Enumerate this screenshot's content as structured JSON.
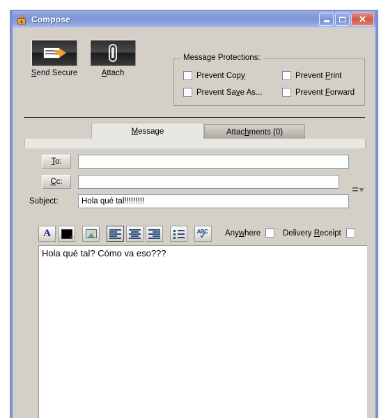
{
  "window": {
    "title": "Compose",
    "icon": "lock-icon",
    "buttons": {
      "minimize": "minimize-icon",
      "maximize": "maximize-icon",
      "close": "close-icon"
    }
  },
  "toolbar": {
    "buttons": [
      {
        "label_pre": "S",
        "label_post": "end Secure",
        "icon": "send-envelope-icon",
        "name": "send-secure-button"
      },
      {
        "label_pre": "A",
        "label_post": "ttach",
        "icon": "paperclip-icon",
        "name": "attach-button"
      }
    ]
  },
  "protections": {
    "title": "Message Protections:",
    "items": [
      {
        "pre": "Prevent Cop",
        "acc": "y",
        "post": "",
        "checked": false,
        "name": "prevent-copy-checkbox"
      },
      {
        "pre": "Prevent Sa",
        "acc": "v",
        "post": "e As...",
        "checked": false,
        "name": "prevent-save-as-checkbox"
      },
      {
        "pre": "Prevent ",
        "acc": "P",
        "post": "rint",
        "checked": false,
        "name": "prevent-print-checkbox"
      },
      {
        "pre": "Prevent ",
        "acc": "F",
        "post": "orward",
        "checked": false,
        "name": "prevent-forward-checkbox"
      }
    ]
  },
  "tabs": [
    {
      "pre": "",
      "acc": "M",
      "post": "essage",
      "active": true,
      "name": "tab-message"
    },
    {
      "pre": "Attac",
      "acc": "h",
      "post": "ments (0)",
      "active": false,
      "name": "tab-attachments"
    }
  ],
  "headers": {
    "to": {
      "pre": "",
      "acc": "T",
      "post": "o:",
      "value": "",
      "placeholder": ""
    },
    "cc": {
      "pre": "",
      "acc": "C",
      "post": "c:",
      "value": "",
      "placeholder": ""
    },
    "subject": {
      "label": "Subject:",
      "value": "Hola qué tal!!!!!!!!!",
      "placeholder": ""
    },
    "cc_dropdown_icon": "chevron-down-icon"
  },
  "format_toolbar": {
    "buttons": [
      {
        "name": "font-button",
        "icon": "font-A-icon"
      },
      {
        "name": "text-color-button",
        "icon": "color-swatch-icon"
      },
      {
        "name": "insert-image-button",
        "icon": "image-icon"
      },
      {
        "name": "align-left-button",
        "icon": "align-left-icon"
      },
      {
        "name": "align-center-button",
        "icon": "align-center-icon"
      },
      {
        "name": "align-right-button",
        "icon": "align-right-icon"
      },
      {
        "name": "bullet-list-button",
        "icon": "bullet-list-icon"
      },
      {
        "name": "spellcheck-button",
        "icon": "spellcheck-abc-icon"
      }
    ],
    "options": [
      {
        "pre": "Any",
        "acc": "w",
        "post": "here",
        "checked": false,
        "name": "anywhere-checkbox"
      },
      {
        "pre": "Delivery ",
        "acc": "R",
        "post": "eceipt",
        "checked": false,
        "name": "delivery-receipt-checkbox"
      }
    ]
  },
  "body": {
    "text": "Hola qué tal? Cómo va eso???"
  },
  "colors": {
    "title_bar": "#7e95d8",
    "frame": "#7b90d4",
    "face": "#d4d0c8",
    "tab_active": "#e8e7e3",
    "field": "#fcfdfd",
    "close_button": "#cf5b4a"
  }
}
